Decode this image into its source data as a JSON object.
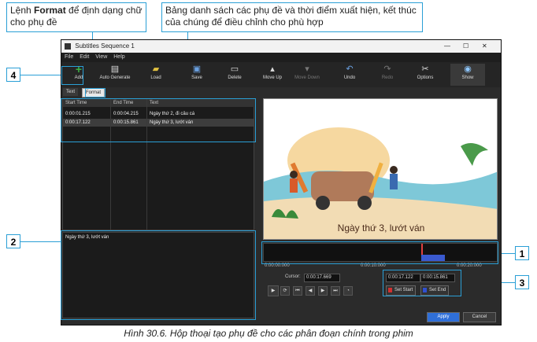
{
  "callouts": {
    "format_note": {
      "prefix": "Lệnh ",
      "bold": "Format",
      "suffix": " để định dạng chữ cho phụ đề"
    },
    "list_note": "Bảng danh sách các phụ đề và thời điểm xuất hiện, kết thúc của chúng để điều chỉnh cho phù hợp",
    "n1": "1",
    "n2": "2",
    "n3": "3",
    "n4": "4"
  },
  "window": {
    "title": "Subtitles Sequence 1",
    "menu": [
      "File",
      "Edit",
      "View",
      "Help"
    ],
    "toolbar": [
      {
        "label": "Add",
        "icon": "plus-icon",
        "color": "#3cb043"
      },
      {
        "label": "Auto Generate",
        "icon": "auto-icon"
      },
      {
        "label": "Load",
        "icon": "folder-icon"
      },
      {
        "label": "Save",
        "icon": "save-icon"
      },
      {
        "label": "Delete",
        "icon": "delete-icon"
      },
      {
        "label": "Move Up",
        "icon": "move-up-icon"
      },
      {
        "label": "Move Down",
        "icon": "move-down-icon"
      },
      {
        "label": "Undo",
        "icon": "undo-icon"
      },
      {
        "label": "Redo",
        "icon": "redo-icon"
      },
      {
        "label": "Options",
        "icon": "options-icon"
      },
      {
        "label": "Show",
        "icon": "eye-icon"
      }
    ],
    "tabs": [
      "Text",
      "Format"
    ],
    "list": {
      "headers": [
        "Start Time",
        "End Time",
        "Text"
      ],
      "rows": [
        [
          "0:00:01.215",
          "0:00:04.215",
          "Ngày thứ 2, đi câu cá"
        ],
        [
          "0:00:17.122",
          "0:00:15.861",
          "Ngày thứ 3, lướt ván"
        ]
      ]
    },
    "text_value": "Ngày thứ 3, lướt ván",
    "preview_caption": "Ngày thứ 3, lướt ván",
    "ruler": [
      "0:00:00.000",
      "0:00:10.000",
      "0:00:20.000"
    ],
    "cursor_label": "Cursor:",
    "cursor_value": "0:00:17.669",
    "start_value": "0:00:17.122",
    "end_value": "0:00:15.861",
    "set_start": "Set Start",
    "set_end": "Set End",
    "apply": "Apply",
    "cancel": "Cancel"
  },
  "caption": "Hình 30.6. Hộp thoại tạo phụ đề cho các phân đoạn chính trong phim"
}
